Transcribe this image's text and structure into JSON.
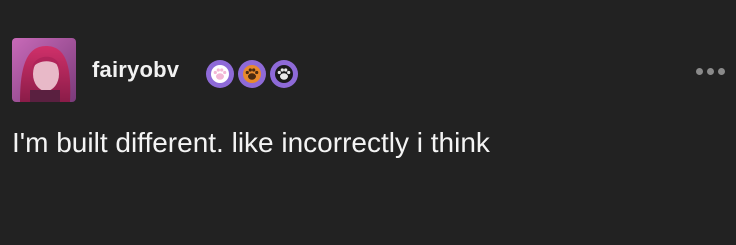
{
  "post": {
    "username": "fairyobv",
    "text": "I'm built different. like incorrectly i think",
    "badges": [
      {
        "icon": "paw-badge-pink-icon",
        "color": "#f3b8d6"
      },
      {
        "icon": "paw-badge-orange-icon",
        "color": "#e88a2c"
      },
      {
        "icon": "paw-badge-black-icon",
        "color": "#1a1a1a"
      }
    ],
    "menu_icon": "more-options-icon"
  },
  "colors": {
    "background": "#222222",
    "text": "#f4f4f4",
    "badge_ring": "#8e6ad8",
    "menu_dots": "#8a8a8a"
  }
}
